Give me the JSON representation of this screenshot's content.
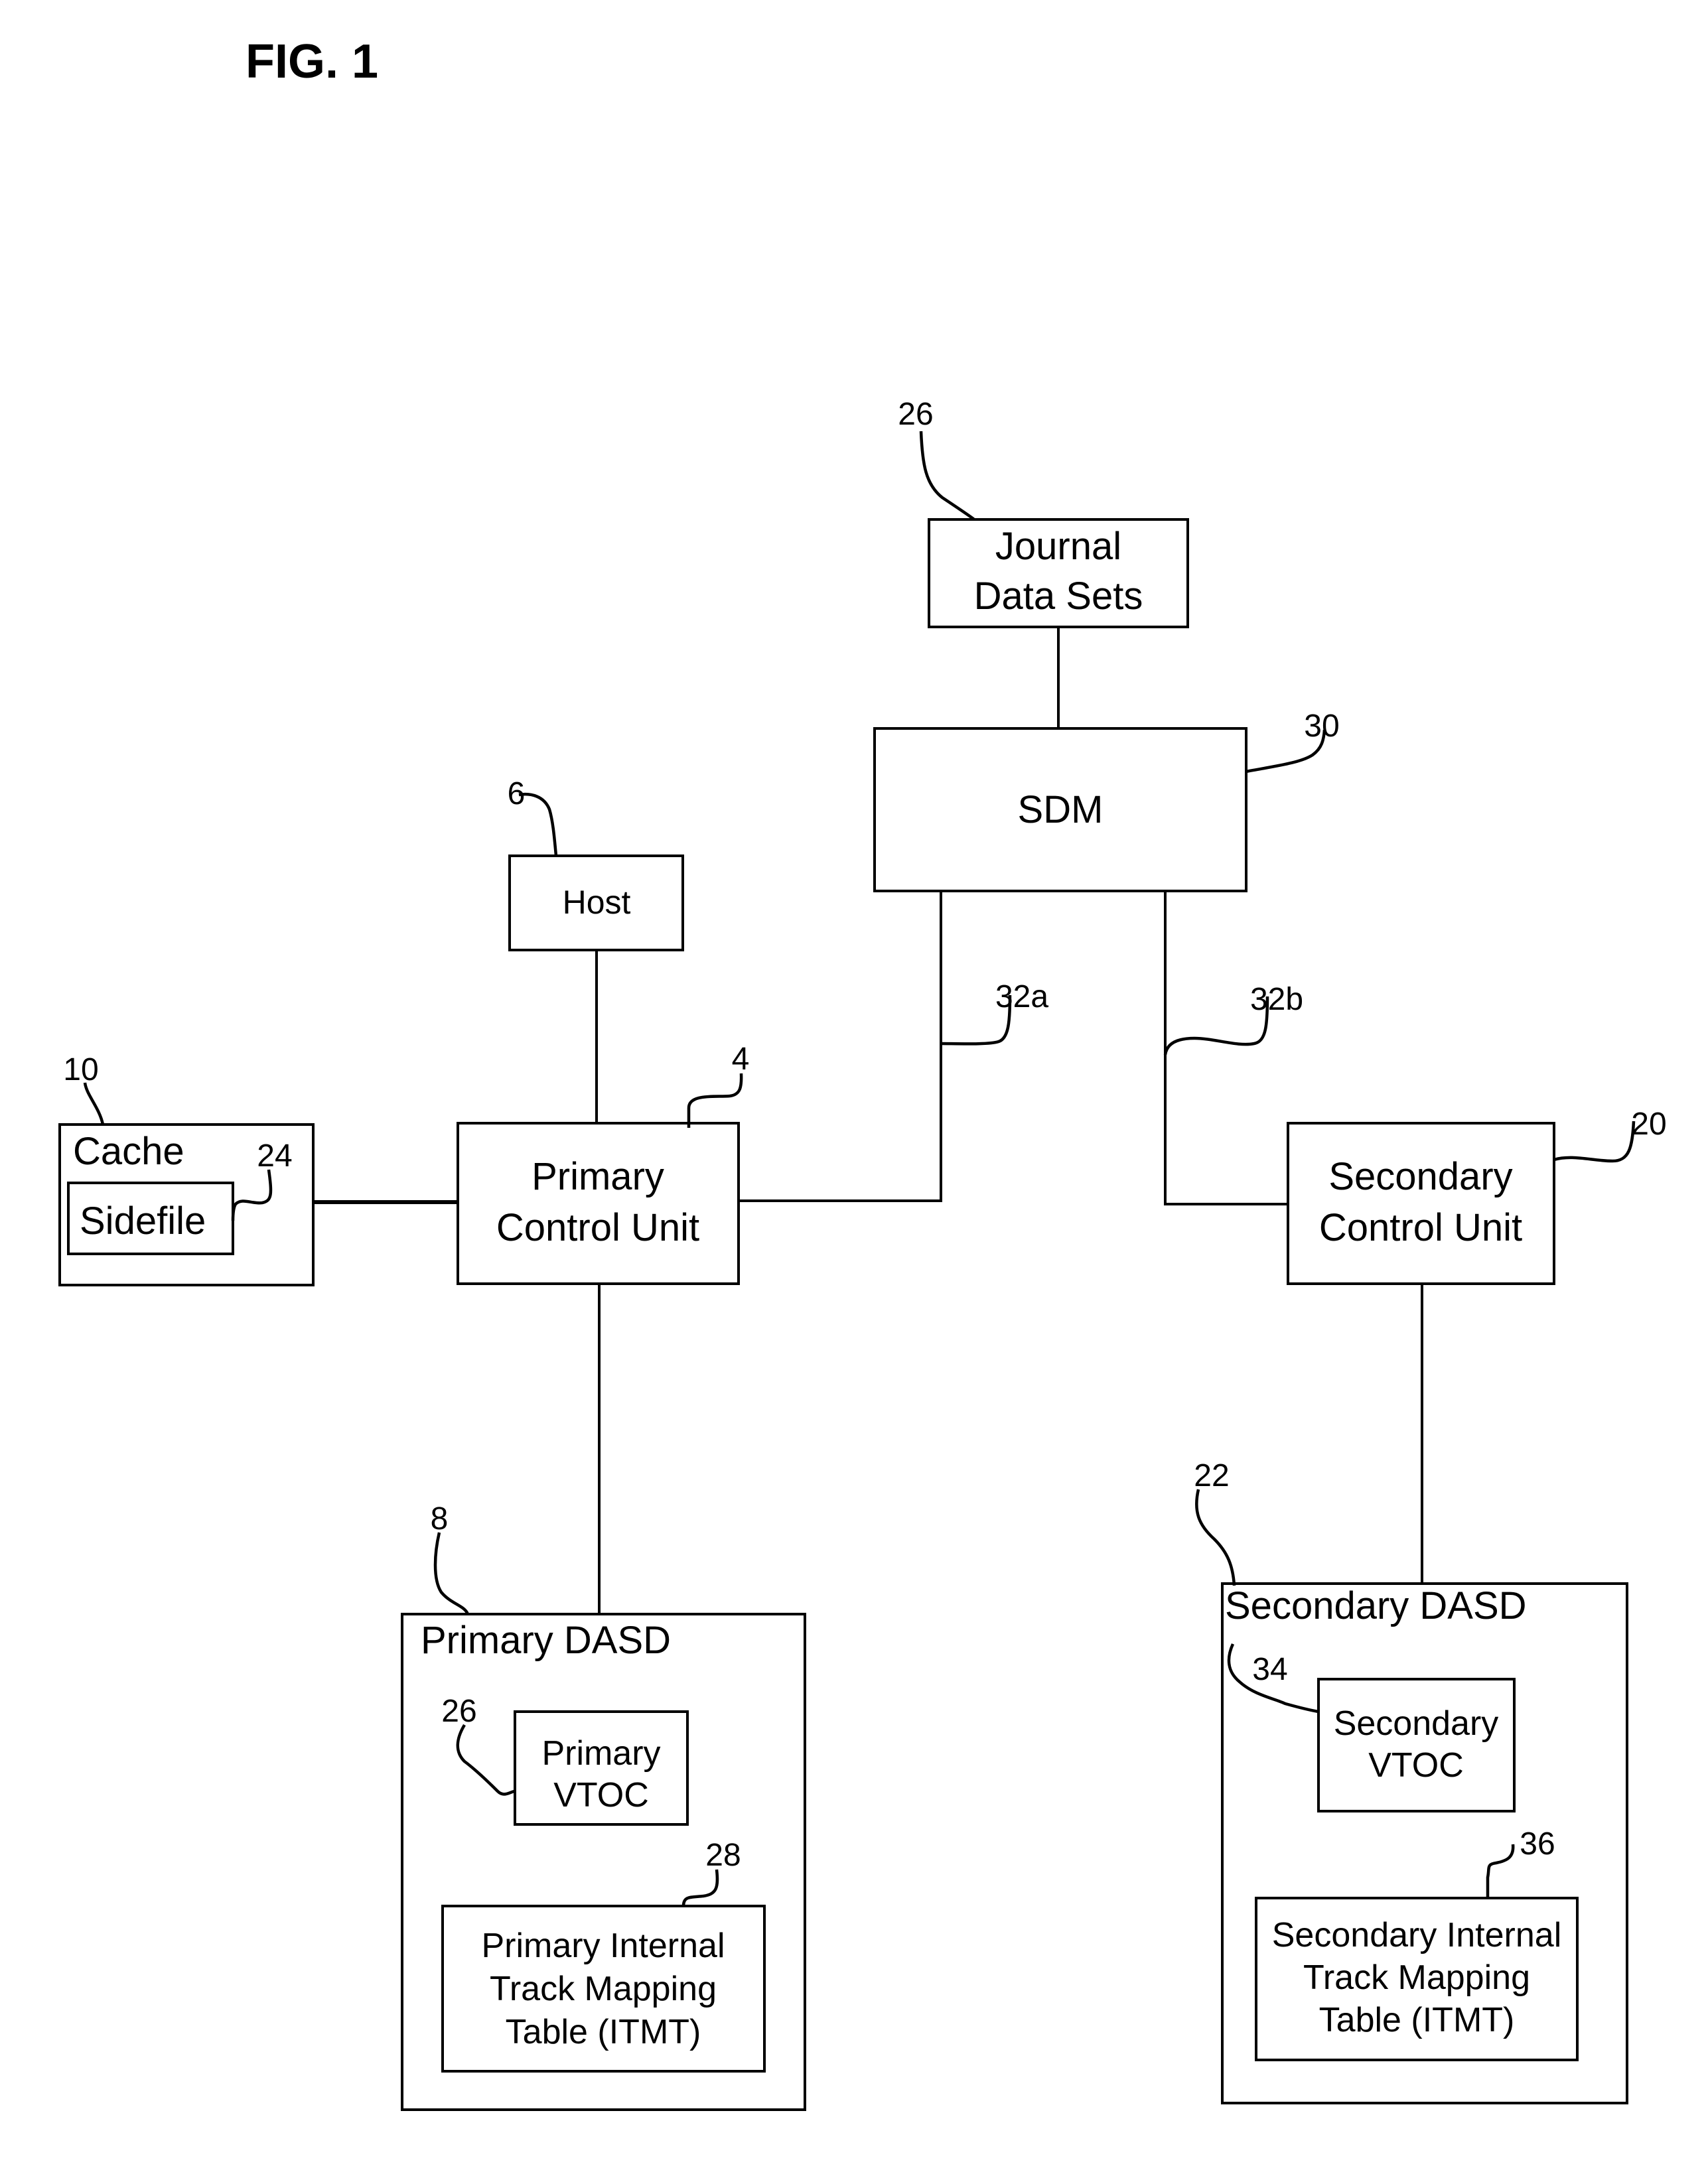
{
  "figure": {
    "title": "FIG. 1"
  },
  "components": {
    "journal": {
      "lines": [
        "Journal",
        "Data Sets"
      ],
      "ref": "26"
    },
    "sdm": {
      "lines": [
        "SDM"
      ],
      "ref": "30"
    },
    "host": {
      "lines": [
        "Host"
      ],
      "ref": "6"
    },
    "cache": {
      "lines": [
        "Cache"
      ],
      "ref": "10"
    },
    "sidefile": {
      "lines": [
        "Sidefile"
      ],
      "ref": "24"
    },
    "primary_cu": {
      "lines": [
        "Primary",
        "Control Unit"
      ],
      "ref": "4"
    },
    "secondary_cu": {
      "lines": [
        "Secondary",
        "Control Unit"
      ],
      "ref": "20"
    },
    "primary_dasd": {
      "lines": [
        "Primary DASD"
      ],
      "ref": "8"
    },
    "primary_vtoc": {
      "lines": [
        "Primary",
        "VTOC"
      ],
      "ref": "26"
    },
    "primary_itmt": {
      "lines": [
        "Primary Internal",
        "Track Mapping",
        "Table (ITMT)"
      ],
      "ref": "28"
    },
    "secondary_dasd": {
      "lines": [
        "Secondary DASD"
      ],
      "ref": "22"
    },
    "secondary_vtoc": {
      "lines": [
        "Secondary",
        "VTOC"
      ],
      "ref": "34"
    },
    "secondary_itmt": {
      "lines": [
        "Secondary Internal",
        "Track Mapping",
        "Table (ITMT)"
      ],
      "ref": "36"
    }
  },
  "links": {
    "sdm_to_primary": {
      "ref": "32a"
    },
    "sdm_to_secondary": {
      "ref": "32b"
    }
  },
  "connections": [
    [
      "journal",
      "sdm"
    ],
    [
      "host",
      "primary_cu"
    ],
    [
      "cache",
      "primary_cu"
    ],
    [
      "sdm",
      "primary_cu"
    ],
    [
      "sdm",
      "secondary_cu"
    ],
    [
      "primary_cu",
      "primary_dasd"
    ],
    [
      "secondary_cu",
      "secondary_dasd"
    ]
  ]
}
